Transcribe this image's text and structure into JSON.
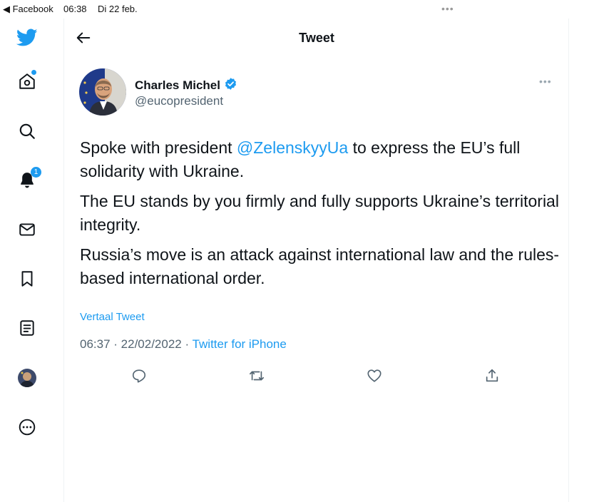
{
  "status_bar": {
    "back_app": "◀ Facebook",
    "time": "06:38",
    "date": "Di 22 feb.",
    "multitask_dots": "•••"
  },
  "sidebar": {
    "items": [
      {
        "name": "twitter-logo"
      },
      {
        "name": "home",
        "has_dot": true
      },
      {
        "name": "explore"
      },
      {
        "name": "notifications",
        "badge": "1"
      },
      {
        "name": "messages"
      },
      {
        "name": "bookmarks"
      },
      {
        "name": "lists"
      },
      {
        "name": "profile"
      },
      {
        "name": "more"
      }
    ]
  },
  "header": {
    "title": "Tweet"
  },
  "tweet": {
    "author_name": "Charles Michel",
    "author_handle": "@eucopresident",
    "more_dots": "•••",
    "paragraph1_pre": "Spoke with president ",
    "paragraph1_mention": "@ZelenskyyUa",
    "paragraph1_post": " to express the EU’s full solidarity with Ukraine.",
    "paragraph2": "The EU stands by you firmly and fully supports Ukraine’s territorial integrity.",
    "paragraph3": "Russia’s move is an attack against  international law and the rules-based international order.",
    "translate_link": "Vertaal Tweet",
    "time": "06:37",
    "separator1": " · ",
    "date": "22/02/2022",
    "separator2": " · ",
    "source": "Twitter for iPhone"
  },
  "colors": {
    "accent": "#1d9bf0",
    "text": "#0f1419",
    "muted": "#536471"
  }
}
